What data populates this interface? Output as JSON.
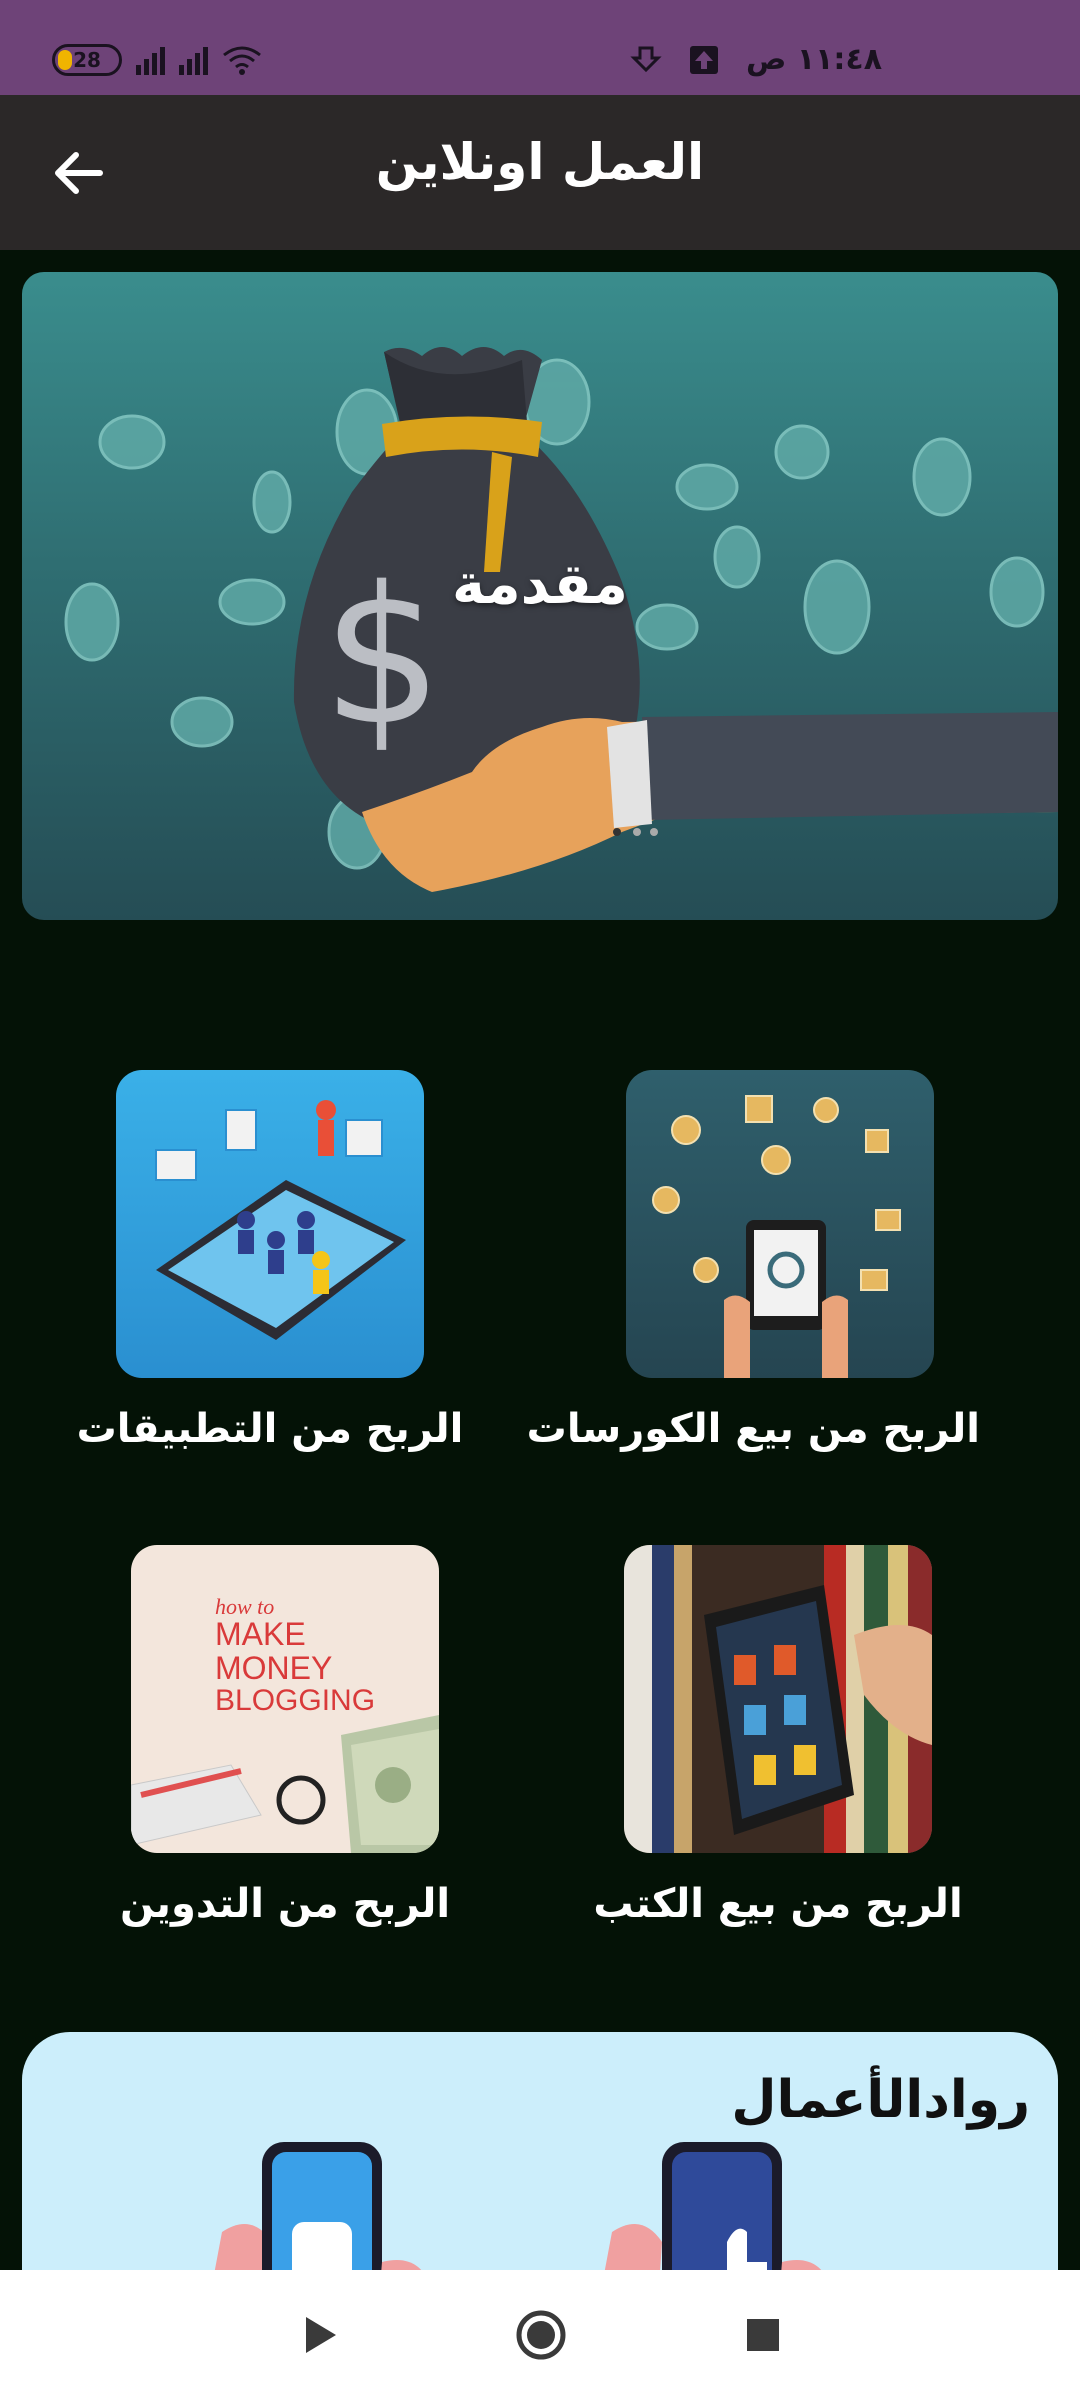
{
  "status_bar": {
    "battery": "28",
    "time": "١١:٤٨ ص"
  },
  "app_bar": {
    "title": "العمل اونلاين",
    "back_icon": "arrow-left-icon"
  },
  "hero": {
    "title": "مقدمة"
  },
  "grid": [
    {
      "label": "الربح من بيع الكورسات",
      "image": "courses-tablet-illustration"
    },
    {
      "label": "الربح من التطبيقات",
      "image": "apps-phone-illustration"
    },
    {
      "label": "الربح من بيع الكتب",
      "image": "ebook-reader-photo"
    },
    {
      "label": "الربح من التدوين",
      "image": "blogging-money-photo"
    }
  ],
  "blogging_thumb_text": [
    "how to",
    "MAKE",
    "MONEY",
    "BLOGGING"
  ],
  "banner": {
    "logo": "روادالأعمال"
  },
  "nav": {
    "back": "triangle-back-icon",
    "home": "circle-home-icon",
    "recents": "square-recents-icon"
  },
  "colors": {
    "status_bar": "#6e4378",
    "app_bar": "#2b2828",
    "background": "#041206"
  }
}
